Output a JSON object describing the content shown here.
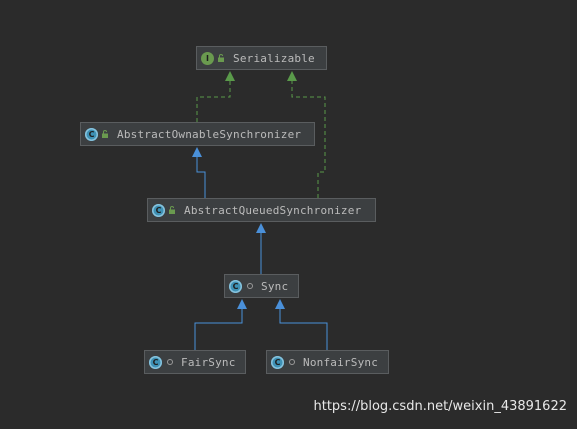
{
  "nodes": {
    "serializable": {
      "name": "Serializable",
      "kind": "interface",
      "icon_letter": "I"
    },
    "aos": {
      "name": "AbstractOwnableSynchronizer",
      "kind": "abstract-class",
      "icon_letter": "C"
    },
    "aqs": {
      "name": "AbstractQueuedSynchronizer",
      "kind": "abstract-class",
      "icon_letter": "C"
    },
    "sync": {
      "name": "Sync",
      "kind": "abstract-class",
      "icon_letter": "C"
    },
    "fair": {
      "name": "FairSync",
      "kind": "class",
      "icon_letter": "C"
    },
    "nonfair": {
      "name": "NonfairSync",
      "kind": "class",
      "icon_letter": "C"
    }
  },
  "relations": [
    {
      "from": "AbstractOwnableSynchronizer",
      "to": "Serializable",
      "type": "implements"
    },
    {
      "from": "AbstractQueuedSynchronizer",
      "to": "Serializable",
      "type": "implements"
    },
    {
      "from": "AbstractQueuedSynchronizer",
      "to": "AbstractOwnableSynchronizer",
      "type": "extends"
    },
    {
      "from": "Sync",
      "to": "AbstractQueuedSynchronizer",
      "type": "extends"
    },
    {
      "from": "FairSync",
      "to": "Sync",
      "type": "extends"
    },
    {
      "from": "NonfairSync",
      "to": "Sync",
      "type": "extends"
    }
  ],
  "colors": {
    "background": "#2b2b2b",
    "node_fill": "#3c3f41",
    "extends_edge": "#4a90d9",
    "implements_edge": "#5a9a4a"
  },
  "watermark": "https://blog.csdn.net/weixin_43891622"
}
